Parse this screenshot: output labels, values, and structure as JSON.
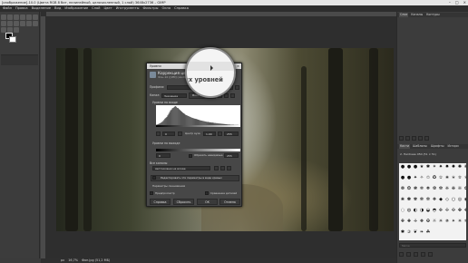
{
  "window": {
    "title": "[изображение]-10.0 (Цвета RGB 8 бит, нелинейный, целочисленный, 1 слой) 3648x2736 – GIMP",
    "controls": [
      "–",
      "□",
      "×"
    ]
  },
  "menubar": [
    "Файл",
    "Правка",
    "Выделение",
    "Вид",
    "Изображение",
    "Слой",
    "Цвет",
    "Инструменты",
    "Фильтры",
    "Окна",
    "Справка"
  ],
  "status": {
    "unit": "px",
    "zoom": "16,7%",
    "text": "Фон.jpg (51,2 МБ)"
  },
  "right_panel": {
    "top_tabs": [
      "Слои",
      "Каналы",
      "Контуры"
    ],
    "bottom_tabs": [
      "Кисти",
      "Шаблоны",
      "Шрифты",
      "Истори"
    ],
    "brush_title": "2. Hardness 050 (51 × 51)",
    "brush_glyphs": [
      "●",
      "●",
      "●",
      "★",
      "✱",
      "✶",
      "✷",
      "✸",
      "✹",
      "✺",
      "❋",
      "●",
      "●",
      "✦",
      "✧",
      "✩",
      "✪",
      "✫",
      "✬",
      "✭",
      "✮",
      "✯",
      "❁",
      "❂",
      "❃",
      "❄",
      "❅",
      "❆",
      "❇",
      "❈",
      "❉",
      "❊",
      "✿",
      "❀",
      "✽",
      "✾",
      "✻",
      "✼",
      "❖",
      "◆",
      "◇",
      "○",
      "◎",
      "◉",
      "◌",
      "◍",
      "◐",
      "◑",
      "◒",
      "◓",
      "✜",
      "✢",
      "✣",
      "✤",
      "✥",
      "✙",
      "✚",
      "✛",
      "❖",
      "✠",
      "☼",
      "☀",
      "✵",
      "✴",
      "✳",
      "✲",
      "✱",
      "✰",
      "❦",
      "❧",
      "☘"
    ],
    "brush_filter_placeholder": "Метка"
  },
  "dialog": {
    "window_title": "Уровни",
    "close": "×",
    "heading": "Коррекция цветовых уровней",
    "subheading": "Фон-10 ([ИМ] (изображение)-10)",
    "presets_label": "Профили:",
    "presets_value": "",
    "channel_label": "Канал:",
    "channel_value": "Значение",
    "channel_reset": "Восстановить",
    "input_levels": "Уровни на входе",
    "input_low": "0",
    "gamma_label": "Центр ауза",
    "gamma": "1,00",
    "input_high": "255",
    "output_levels": "Уровни на выходе",
    "output_low": "0",
    "output_high": "255",
    "clip_label": "Обрезать невидимые",
    "all_channels": "Все каналы",
    "all_channels_combo": "Автоуровни на входе",
    "edit_curves": "Редактировать эти параметры в виде кривых",
    "blend_label": "Параметры смешивания",
    "preview_label": "Предпросмотр",
    "split_view": "Сравнение деталей",
    "btn_help": "Справка",
    "btn_reset": "Сбросить",
    "btn_ok": "ОК",
    "btn_cancel": "Отмена",
    "histogram": [
      2,
      3,
      5,
      7,
      9,
      12,
      15,
      19,
      24,
      30,
      34,
      38,
      45,
      52,
      60,
      68,
      72,
      78,
      80,
      84,
      88,
      85,
      80,
      79,
      74,
      70,
      66,
      62,
      58,
      55,
      52,
      48,
      46,
      44,
      42,
      40,
      38,
      36,
      34,
      33,
      31,
      30,
      29,
      28,
      26,
      25,
      23,
      22,
      21,
      20,
      19,
      18,
      17,
      16,
      15,
      15,
      14,
      13,
      13,
      12,
      12,
      11,
      10,
      10,
      9,
      9,
      8,
      8,
      7,
      7,
      6,
      6,
      5,
      5,
      4,
      4,
      3,
      3,
      3,
      2,
      2,
      2,
      2,
      1,
      1,
      1,
      1,
      1,
      0,
      0
    ]
  },
  "magnifier": {
    "text": "ых уровней"
  }
}
